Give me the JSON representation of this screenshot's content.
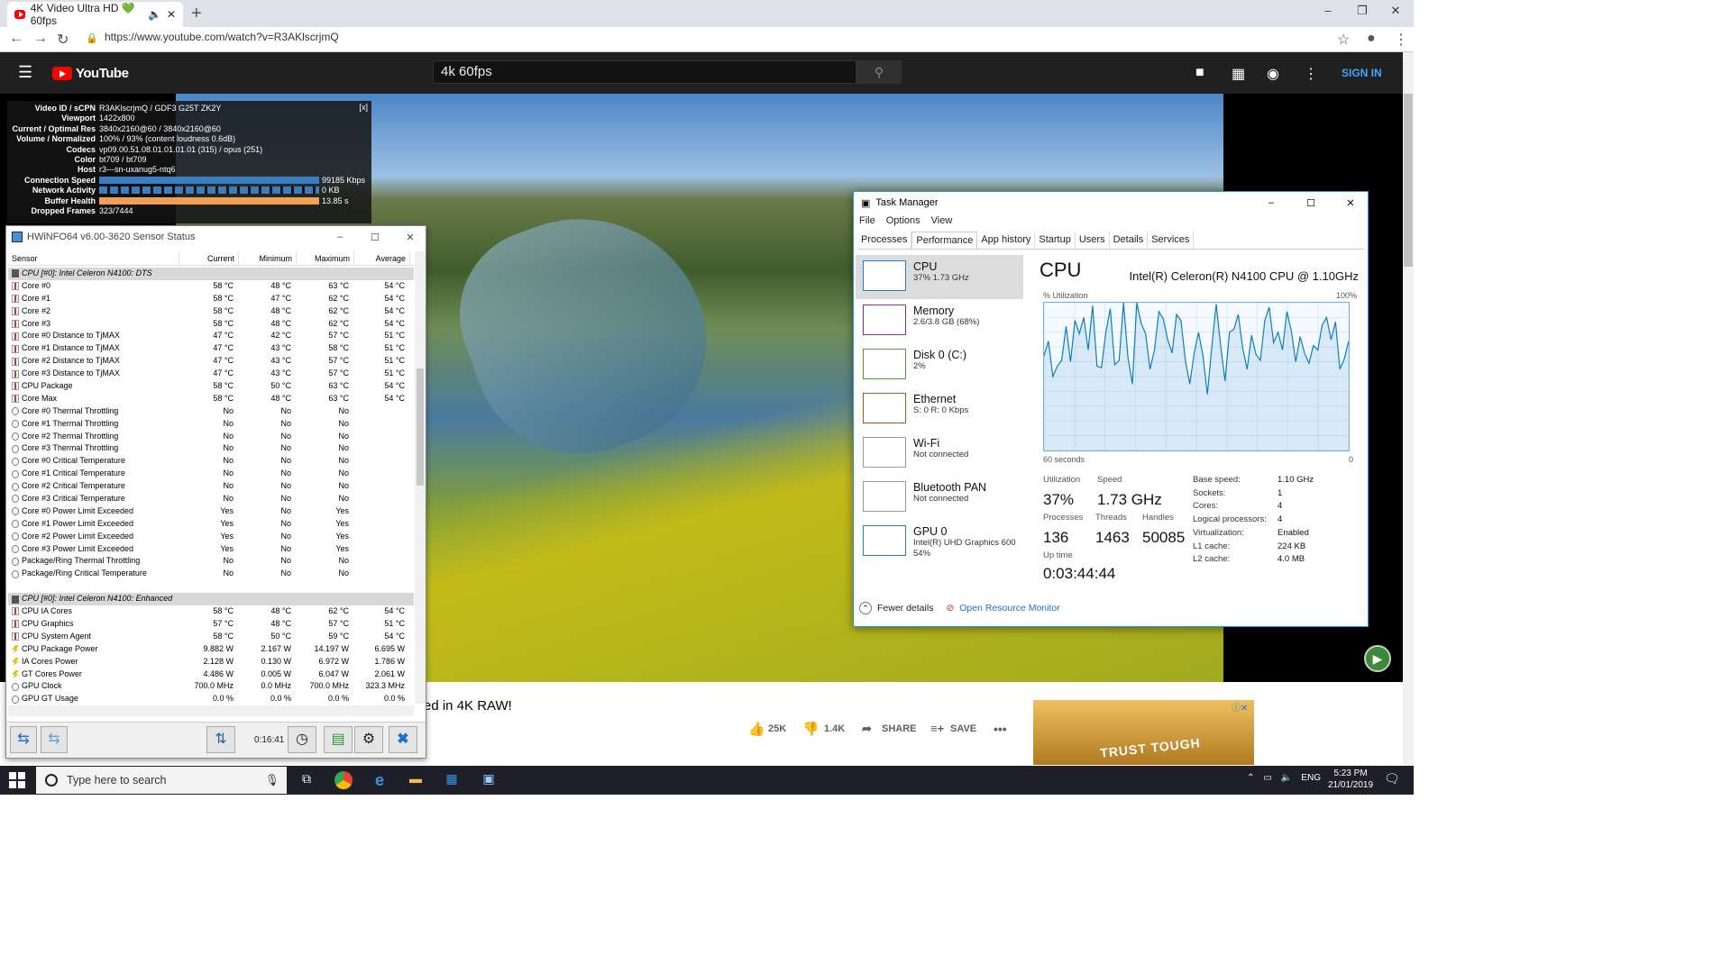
{
  "browser": {
    "tab_title": "4K Video Ultra HD 💚 60fps",
    "url": "https://www.youtube.com/watch?v=R3AKlscrjmQ"
  },
  "youtube": {
    "logo": "YouTube",
    "search_value": "4k 60fps",
    "sign_in": "SIGN IN",
    "video_title_fragment": "ed in 4K RAW!",
    "likes": "25K",
    "dislikes": "1.4K",
    "share": "SHARE",
    "save": "SAVE",
    "ad_text": "TRUST TOUGH"
  },
  "stats": {
    "close": "[x]",
    "rows": [
      {
        "label": "Video ID / sCPN",
        "value": "R3AKlscrjmQ / GDF3 G25T ZK2Y"
      },
      {
        "label": "Viewport",
        "value": "1422x800"
      },
      {
        "label": "Current / Optimal Res",
        "value": "3840x2160@60 / 3840x2160@60"
      },
      {
        "label": "Volume / Normalized",
        "value": "100% / 93% (content loudness 0.6dB)"
      },
      {
        "label": "Codecs",
        "value": "vp09.00.51.08.01.01.01.01 (315) / opus (251)"
      },
      {
        "label": "Color",
        "value": "bt709 / bt709"
      },
      {
        "label": "Host",
        "value": "r3---sn-uxanug5-ntq6"
      }
    ],
    "bars": [
      {
        "label": "Connection Speed",
        "value": "99185 Kbps",
        "color": "#3b7ebf"
      },
      {
        "label": "Network Activity",
        "value": "0 KB",
        "color": "#3b7ebf"
      },
      {
        "label": "Buffer Health",
        "value": "13.85 s",
        "color": "#f0a050"
      }
    ],
    "dropped_label": "Dropped Frames",
    "dropped_value": "323/7444"
  },
  "hwinfo": {
    "title": "HWiNFO64 v6.00-3620 Sensor Status",
    "headers": [
      "Sensor",
      "Current",
      "Minimum",
      "Maximum",
      "Average"
    ],
    "rows": [
      {
        "g": true,
        "n": "CPU [#0]: Intel Celeron N4100: DTS"
      },
      {
        "i": "t",
        "n": "Core #0",
        "v": [
          "58 °C",
          "48 °C",
          "63 °C",
          "54 °C"
        ]
      },
      {
        "i": "t",
        "n": "Core #1",
        "v": [
          "58 °C",
          "47 °C",
          "62 °C",
          "54 °C"
        ]
      },
      {
        "i": "t",
        "n": "Core #2",
        "v": [
          "58 °C",
          "48 °C",
          "62 °C",
          "54 °C"
        ]
      },
      {
        "i": "t",
        "n": "Core #3",
        "v": [
          "58 °C",
          "48 °C",
          "62 °C",
          "54 °C"
        ]
      },
      {
        "i": "t",
        "n": "Core #0 Distance to TjMAX",
        "v": [
          "47 °C",
          "42 °C",
          "57 °C",
          "51 °C"
        ]
      },
      {
        "i": "t",
        "n": "Core #1 Distance to TjMAX",
        "v": [
          "47 °C",
          "43 °C",
          "58 °C",
          "51 °C"
        ]
      },
      {
        "i": "t",
        "n": "Core #2 Distance to TjMAX",
        "v": [
          "47 °C",
          "43 °C",
          "57 °C",
          "51 °C"
        ]
      },
      {
        "i": "t",
        "n": "Core #3 Distance to TjMAX",
        "v": [
          "47 °C",
          "43 °C",
          "57 °C",
          "51 °C"
        ]
      },
      {
        "i": "t",
        "n": "CPU Package",
        "v": [
          "58 °C",
          "50 °C",
          "63 °C",
          "54 °C"
        ]
      },
      {
        "i": "t",
        "n": "Core Max",
        "v": [
          "58 °C",
          "48 °C",
          "63 °C",
          "54 °C"
        ]
      },
      {
        "i": "c",
        "n": "Core #0 Thermal Throttling",
        "v": [
          "No",
          "No",
          "No",
          ""
        ]
      },
      {
        "i": "c",
        "n": "Core #1 Thermal Throttling",
        "v": [
          "No",
          "No",
          "No",
          ""
        ]
      },
      {
        "i": "c",
        "n": "Core #2 Thermal Throttling",
        "v": [
          "No",
          "No",
          "No",
          ""
        ]
      },
      {
        "i": "c",
        "n": "Core #3 Thermal Throttling",
        "v": [
          "No",
          "No",
          "No",
          ""
        ]
      },
      {
        "i": "c",
        "n": "Core #0 Critical Temperature",
        "v": [
          "No",
          "No",
          "No",
          ""
        ]
      },
      {
        "i": "c",
        "n": "Core #1 Critical Temperature",
        "v": [
          "No",
          "No",
          "No",
          ""
        ]
      },
      {
        "i": "c",
        "n": "Core #2 Critical Temperature",
        "v": [
          "No",
          "No",
          "No",
          ""
        ]
      },
      {
        "i": "c",
        "n": "Core #3 Critical Temperature",
        "v": [
          "No",
          "No",
          "No",
          ""
        ]
      },
      {
        "i": "c",
        "n": "Core #0 Power Limit Exceeded",
        "v": [
          "Yes",
          "No",
          "Yes",
          ""
        ]
      },
      {
        "i": "c",
        "n": "Core #1 Power Limit Exceeded",
        "v": [
          "Yes",
          "No",
          "Yes",
          ""
        ]
      },
      {
        "i": "c",
        "n": "Core #2 Power Limit Exceeded",
        "v": [
          "Yes",
          "No",
          "Yes",
          ""
        ]
      },
      {
        "i": "c",
        "n": "Core #3 Power Limit Exceeded",
        "v": [
          "Yes",
          "No",
          "Yes",
          ""
        ]
      },
      {
        "i": "c",
        "n": "Package/Ring Thermal Throttling",
        "v": [
          "No",
          "No",
          "No",
          ""
        ]
      },
      {
        "i": "c",
        "n": "Package/Ring Critical Temperature",
        "v": [
          "No",
          "No",
          "No",
          ""
        ]
      },
      {
        "blank": true
      },
      {
        "g": true,
        "n": "CPU [#0]: Intel Celeron N4100: Enhanced"
      },
      {
        "i": "t",
        "n": "CPU IA Cores",
        "v": [
          "58 °C",
          "48 °C",
          "62 °C",
          "54 °C"
        ]
      },
      {
        "i": "t",
        "n": "CPU Graphics",
        "v": [
          "57 °C",
          "48 °C",
          "57 °C",
          "51 °C"
        ]
      },
      {
        "i": "t",
        "n": "CPU System Agent",
        "v": [
          "58 °C",
          "50 °C",
          "59 °C",
          "54 °C"
        ]
      },
      {
        "i": "p",
        "n": "CPU Package Power",
        "v": [
          "9.882 W",
          "2.167 W",
          "14.197 W",
          "6.695 W"
        ]
      },
      {
        "i": "p",
        "n": "IA Cores Power",
        "v": [
          "2.128 W",
          "0.130 W",
          "6.972 W",
          "1.786 W"
        ]
      },
      {
        "i": "p",
        "n": "GT Cores Power",
        "v": [
          "4.486 W",
          "0.005 W",
          "6.047 W",
          "2.061 W"
        ]
      },
      {
        "i": "c",
        "n": "GPU Clock",
        "v": [
          "700.0 MHz",
          "0.0 MHz",
          "700.0 MHz",
          "323.3 MHz"
        ]
      },
      {
        "i": "c",
        "n": "GPU GT Usage",
        "v": [
          "0.0 %",
          "0.0 %",
          "0.0 %",
          "0.0 %"
        ]
      }
    ],
    "elapsed": "0:16:41"
  },
  "taskmgr": {
    "title": "Task Manager",
    "menu": [
      "File",
      "Options",
      "View"
    ],
    "tabs": [
      "Processes",
      "Performance",
      "App history",
      "Startup",
      "Users",
      "Details",
      "Services"
    ],
    "active_tab": "Performance",
    "side": [
      {
        "name": "CPU",
        "sub": "37% 1.73 GHz",
        "color": "#1e7fd0"
      },
      {
        "name": "Memory",
        "sub": "2.6/3.8 GB (68%)",
        "color": "#8b2b9a"
      },
      {
        "name": "Disk 0 (C:)",
        "sub": "2%",
        "color": "#4aa33a"
      },
      {
        "name": "Ethernet",
        "sub": "S: 0 R: 0 Kbps",
        "color": "#a85a1e"
      },
      {
        "name": "Wi-Fi",
        "sub": "Not connected",
        "color": "#999999"
      },
      {
        "name": "Bluetooth PAN",
        "sub": "Not connected",
        "color": "#999999"
      },
      {
        "name": "GPU 0",
        "sub": "Intel(R) UHD Graphics 600",
        "sub2": "54%",
        "color": "#1e7fd0"
      }
    ],
    "cpu_title": "CPU",
    "cpu_model": "Intel(R) Celeron(R) N4100 CPU @ 1.10GHz",
    "util_label": "% Utilization",
    "util_max": "100%",
    "time_label": "60 seconds",
    "time_zero": "0",
    "utilization_series": [
      64,
      74,
      50,
      57,
      61,
      84,
      60,
      88,
      79,
      90,
      68,
      98,
      57,
      56,
      80,
      96,
      58,
      61,
      100,
      63,
      45,
      102,
      86,
      79,
      55,
      68,
      94,
      89,
      75,
      66,
      92,
      88,
      61,
      45,
      66,
      80,
      64,
      38,
      70,
      99,
      71,
      47,
      80,
      82,
      92,
      69,
      55,
      78,
      65,
      61,
      88,
      97,
      73,
      80,
      68,
      94,
      81,
      60,
      77,
      66,
      59,
      71,
      68,
      85,
      90,
      75,
      87,
      55,
      62,
      74
    ],
    "stats": [
      {
        "label": "Utilization",
        "value": "37%"
      },
      {
        "label": "Speed",
        "value": "1.73 GHz"
      },
      {
        "label": "Processes",
        "value": "136"
      },
      {
        "label": "Threads",
        "value": "1463"
      },
      {
        "label": "Handles",
        "value": "50085"
      },
      {
        "label": "Up time",
        "value": "0:03:44:44"
      }
    ],
    "specs": [
      {
        "k": "Base speed:",
        "v": "1.10 GHz"
      },
      {
        "k": "Sockets:",
        "v": "1"
      },
      {
        "k": "Cores:",
        "v": "4"
      },
      {
        "k": "Logical processors:",
        "v": "4"
      },
      {
        "k": "Virtualization:",
        "v": "Enabled"
      },
      {
        "k": "L1 cache:",
        "v": "224 KB"
      },
      {
        "k": "L2 cache:",
        "v": "4.0 MB"
      }
    ],
    "fewer": "Fewer details",
    "monitor": "Open Resource Monitor"
  },
  "taskbar": {
    "search_placeholder": "Type here to search",
    "lang": "ENG",
    "time": "5:23 PM",
    "date": "21/01/2019"
  }
}
